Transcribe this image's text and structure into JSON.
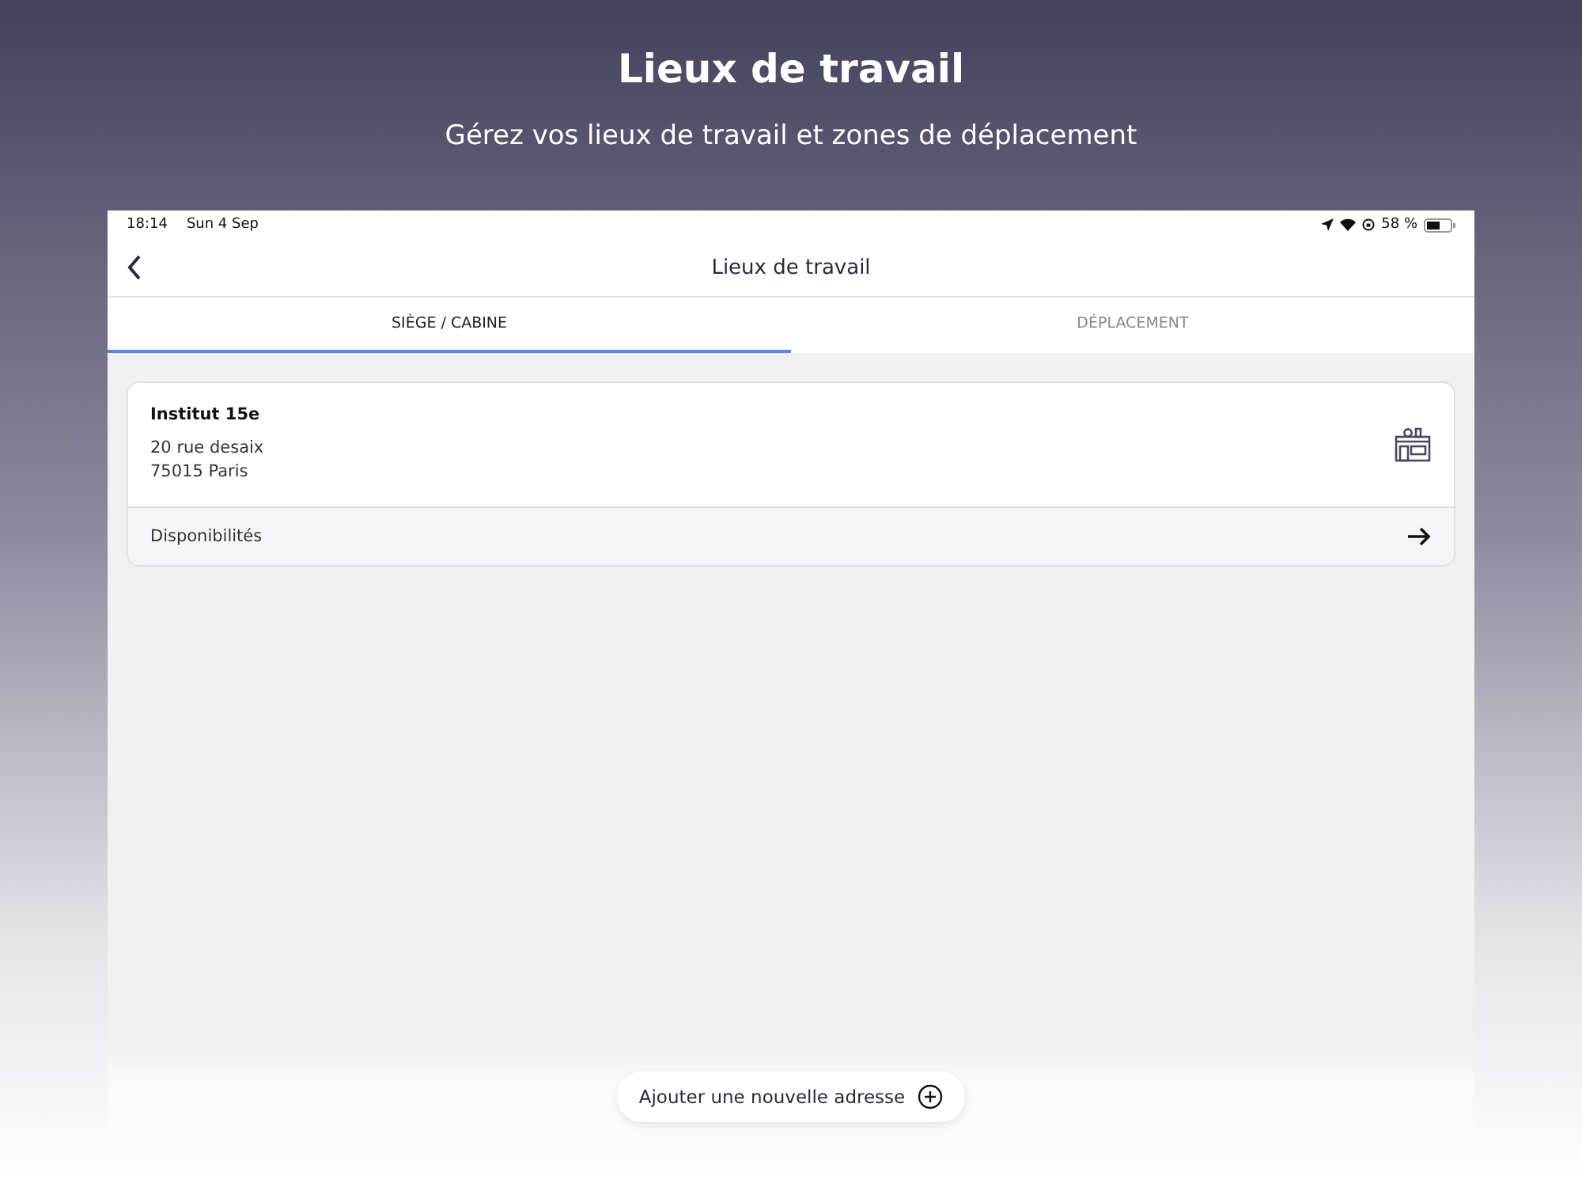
{
  "header": {
    "title": "Lieux de travail",
    "subtitle": "Gérez vos lieux de travail et zones de déplacement"
  },
  "status_bar": {
    "time": "18:14",
    "date": "Sun 4 Sep",
    "battery": "58 %"
  },
  "nav": {
    "title": "Lieux de travail"
  },
  "tabs": [
    {
      "label": "SIÈGE / CABINE",
      "selected": true
    },
    {
      "label": "DÉPLACEMENT",
      "selected": false
    }
  ],
  "locations": [
    {
      "name": "Institut 15e",
      "street": "20 rue desaix",
      "city": "75015 Paris",
      "action": "Disponibilités"
    }
  ],
  "add_button": {
    "label": "Ajouter une nouvelle adresse"
  }
}
